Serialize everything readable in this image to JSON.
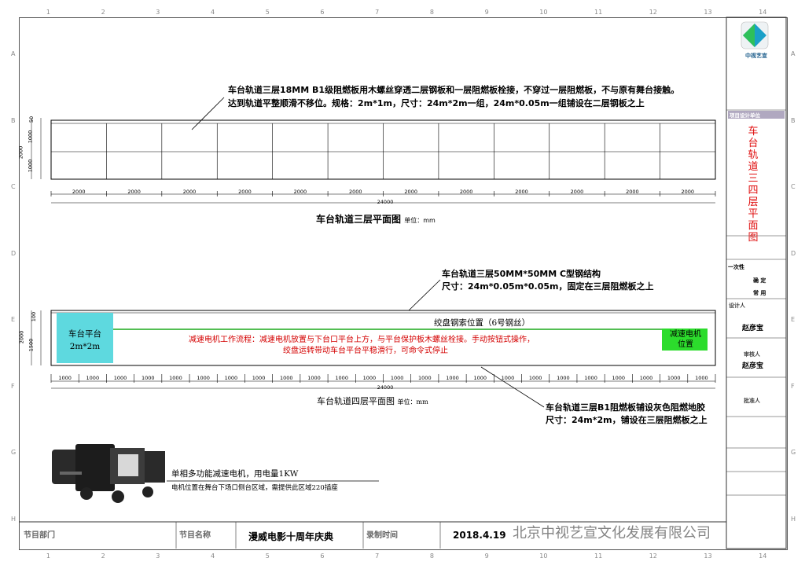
{
  "border_numbers": {
    "top": [
      "1",
      "2",
      "3",
      "4",
      "5",
      "6",
      "7",
      "8",
      "9",
      "10",
      "11",
      "12",
      "13",
      "14"
    ],
    "bottom": [
      "1",
      "2",
      "3",
      "4",
      "5",
      "6",
      "7",
      "8",
      "9",
      "10",
      "11",
      "12",
      "13",
      "14"
    ],
    "left": [
      "A",
      "B",
      "C",
      "D",
      "E",
      "F",
      "G",
      "H"
    ],
    "right": [
      "A",
      "B",
      "C",
      "D",
      "E",
      "F",
      "G",
      "H"
    ]
  },
  "plan3": {
    "note_line1": "车台轨道三层18MM B1级阻燃板用木螺丝穿透二层钢板和一层阻燃板栓接，不穿过一层阻燃板，不与原有舞台接触。",
    "note_line2": "达到轨道平整顺滑不移位。规格：2m*1m，尺寸：24m*2m一组，24m*0.05m一组铺设在二层钢板之上",
    "vdims": [
      "50",
      "1000",
      "1000",
      "2000"
    ],
    "segment_dims": [
      "2000",
      "2000",
      "2000",
      "2000",
      "2000",
      "2000",
      "2000",
      "2000",
      "2000",
      "2000",
      "2000",
      "2000"
    ],
    "total_dim": "24000",
    "title": "车台轨道三层平面图",
    "unit": "单位：mm"
  },
  "plan4": {
    "note1_line1": "车台轨道三层50MM*50MM C型钢结构",
    "note1_line2": "尺寸：24m*0.05m*0.05m，固定在三层阻燃板之上",
    "platform_label_1": "车台平台",
    "platform_label_2": "2m*2m",
    "winch_label": "绞盘钢索位置（6号钢丝）",
    "motor_label_1": "减速电机",
    "motor_label_2": "位置",
    "process_line1": "减速电机工作流程：减速电机放置与下台口平台上方，与平台保护板木螺丝栓接。手动按钮式操作，",
    "process_line2": "绞盘运转带动车台平台平稳滑行，可命令式停止",
    "vdims": [
      "100",
      "1500",
      "2000"
    ],
    "segment_dims": [
      "1000",
      "1000",
      "1000",
      "1000",
      "1000",
      "1000",
      "1000",
      "1000",
      "1000",
      "1000",
      "1000",
      "1000",
      "1000",
      "1000",
      "1000",
      "1000",
      "1000",
      "1000",
      "1000",
      "1000",
      "1000",
      "1000",
      "1000",
      "1000"
    ],
    "total_dim": "24000",
    "title": "车台轨道四层平面图",
    "unit": "单位：mm",
    "note2_line1": "车台轨道三层B1阻燃板铺设灰色阻燃地胶",
    "note2_line2": "尺寸：24m*2m，铺设在三层阻燃板之上"
  },
  "motor": {
    "caption1": "单相多功能减速电机，用电量1KW",
    "caption2": "电机位置在舞台下场口侧台区域，需提供此区域220插座"
  },
  "titleblock": {
    "company_logo_text": "中视艺宣",
    "sheet_title": "车台轨道三四层平面图",
    "label_stamp": "项目设计单位",
    "labels": [
      "设计人",
      "审核人",
      "批准人"
    ],
    "designer": "赵彦宝",
    "reviewer": "赵彦宝",
    "version_label": "一次性",
    "status_label": "确 定",
    "use_label": "常 用"
  },
  "bottom_strip": {
    "dept_label": "节目部门",
    "name_label": "节目名称",
    "program_name": "漫威电影十周年庆典",
    "time_label": "录制时间",
    "date_value": "2018.4.19",
    "watermark": "北京中视艺宣文化发展有限公司"
  },
  "colors": {
    "platform": "#5ed9df",
    "motor": "#2cdc2c",
    "winch_line": "#1aa81a",
    "process_text": "#d40000",
    "sheet_title": "#e01010",
    "title_stamp_bg": "#b0a8c0"
  }
}
